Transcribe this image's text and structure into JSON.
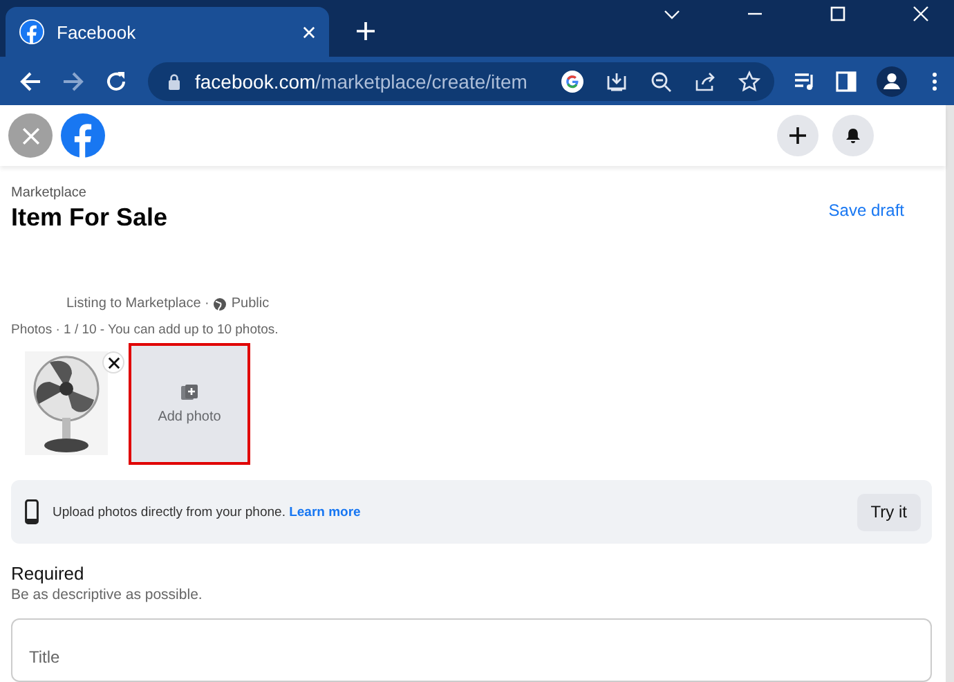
{
  "browser": {
    "tab_title": "Facebook",
    "url": {
      "host": "facebook.com",
      "path": "/marketplace/create/item"
    }
  },
  "header": {
    "breadcrumb": "Marketplace",
    "title": "Item For Sale",
    "save_label": "Save draft"
  },
  "listing": {
    "text": "Listing to Marketplace ·",
    "audience": "Public"
  },
  "photos": {
    "caption": "Photos · 1 / 10 - You can add up to 10 photos.",
    "add_label": "Add photo",
    "highlighted": true
  },
  "phone_banner": {
    "text": "Upload photos directly from your phone.",
    "link": "Learn more",
    "button": "Try it"
  },
  "required": {
    "heading": "Required",
    "hint": "Be as descriptive as possible.",
    "fields": [
      {
        "placeholder": "Title"
      }
    ]
  }
}
